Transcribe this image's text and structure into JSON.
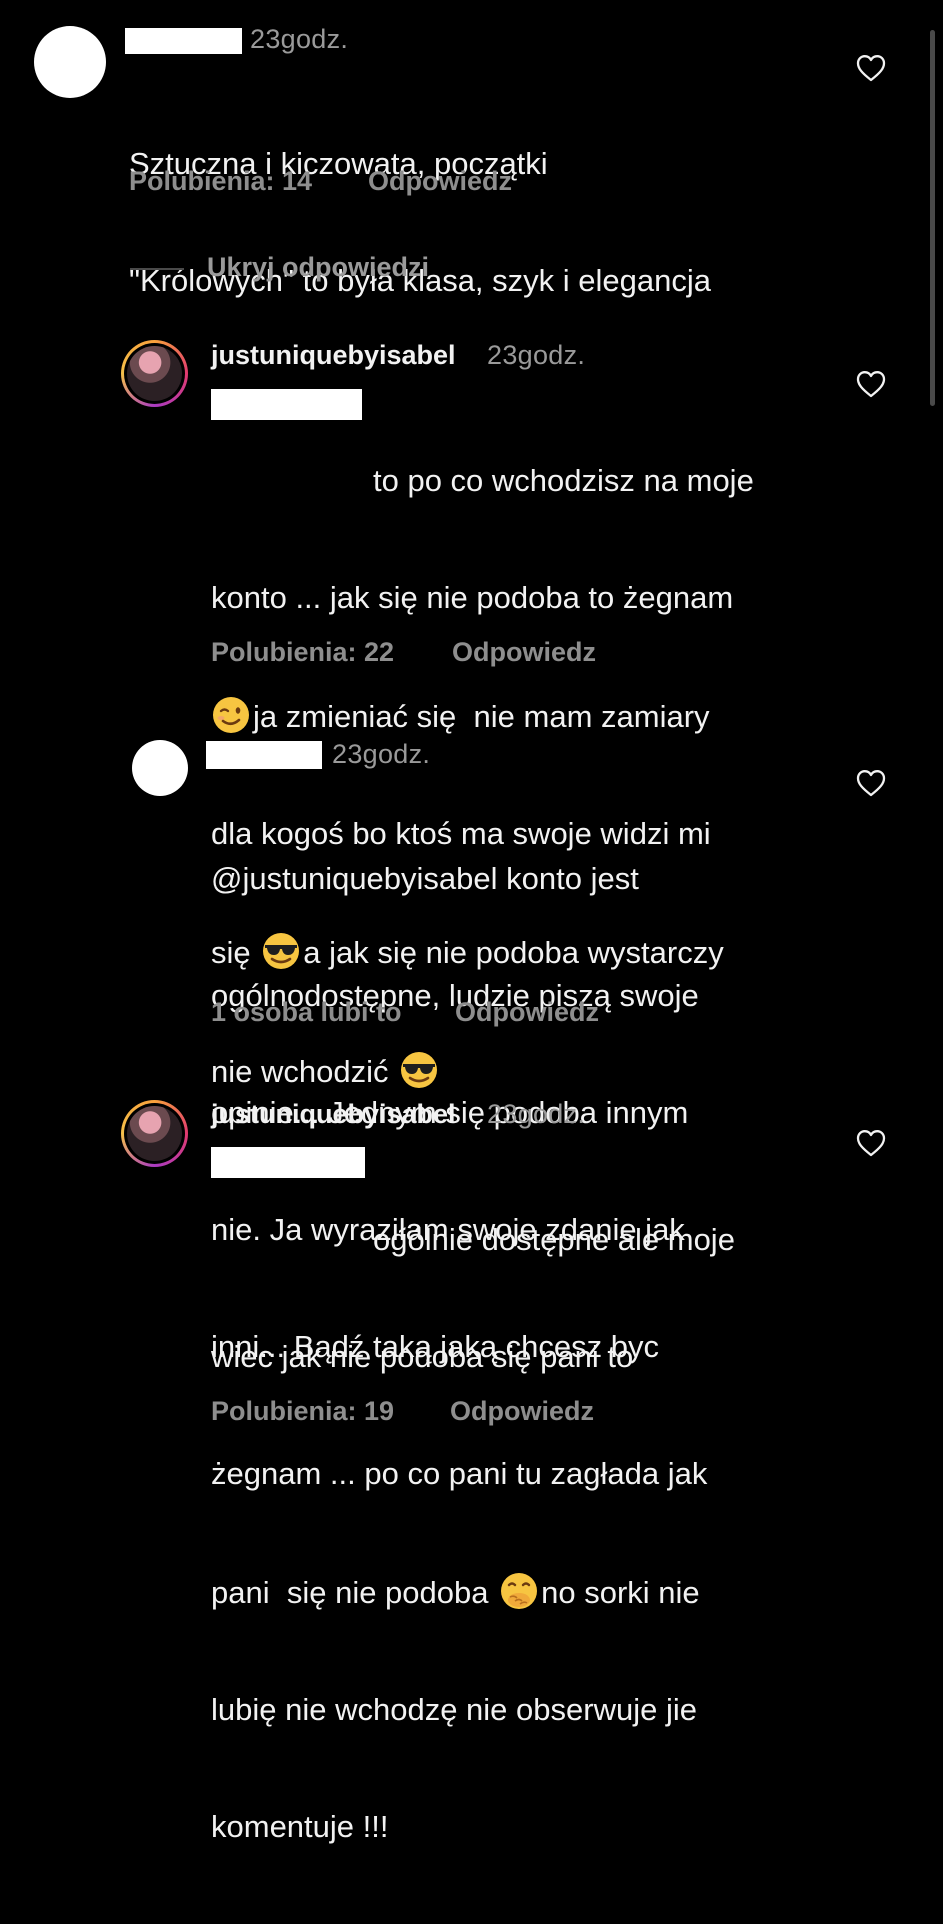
{
  "colors": {
    "background": "#000000",
    "text": "#f2f2f2",
    "muted": "#8e8e8e",
    "redaction": "#ffffff"
  },
  "icons": {
    "like": "heart-outline-icon",
    "wink_emoji": "winking-face-emoji",
    "sunglasses_emoji": "smiling-face-with-sunglasses-emoji",
    "hand_over_mouth_emoji": "face-with-hand-over-mouth-emoji"
  },
  "comment1": {
    "time": "23godz.",
    "text_line1": "Sztuczna i kiczowata, początki",
    "text_line2": "\"Królowych\" to była klasa, szyk i elegancja",
    "likes": "Polubienia: 14",
    "reply": "Odpowiedz"
  },
  "hide_replies": "Ukryj odpowiedzi",
  "reply1": {
    "username": "justuniquebyisabel",
    "time": "23godz.",
    "line1": "to po co wchodzisz na moje",
    "line2": "konto ... jak się nie podoba to żegnam",
    "line3": "ja zmieniać się  nie mam zamiary",
    "line4": "dla kogoś bo ktoś ma swoje widzi mi",
    "line5a": "się",
    "line5b": "a jak się nie podoba wystarczy",
    "line6": "nie wchodzić",
    "likes": "Polubienia: 22",
    "reply": "Odpowiedz"
  },
  "reply2": {
    "time": "23godz.",
    "line1": "@justuniquebyisabel konto jest",
    "line2": "ogólnodostępne, ludzie piszą swoje",
    "line3": "opinie... Jednym się podoba innym",
    "line4": "nie. Ja wyraziłam swoje zdanie jak",
    "line5": "inni... Bądź taką jaką chcesz byc",
    "likes": "1 osoba lubi to",
    "reply": "Odpowiedz"
  },
  "reply3": {
    "username": "justuniquebyisabel",
    "time": "23godz.",
    "line1": "ogólnie dostępne ale moje",
    "line2": "wiec jak nie podoba się pani to",
    "line3": "żegnam ... po co pani tu zagłada jak",
    "line4a": "pani  się nie podoba",
    "line4b": "no sorki nie",
    "line5": "lubię nie wchodzę nie obserwuje jie",
    "line6": "komentuje !!!",
    "likes": "Polubienia: 19",
    "reply": "Odpowiedz"
  }
}
